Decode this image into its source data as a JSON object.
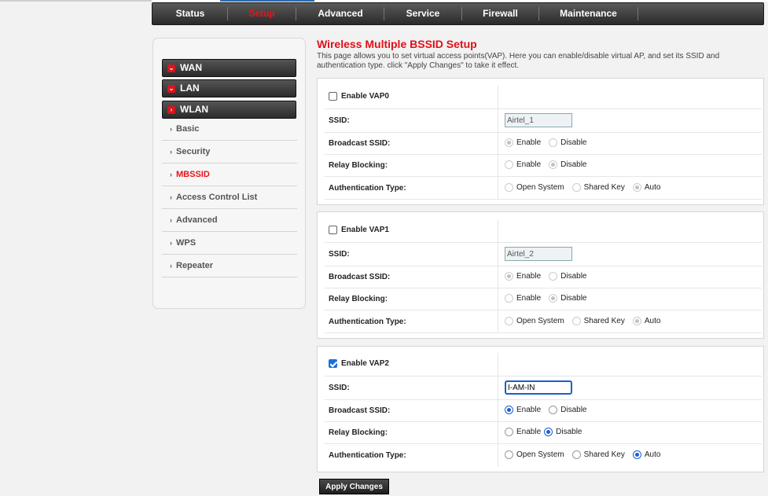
{
  "topnav": {
    "tabs": [
      {
        "label": "Status"
      },
      {
        "label": "Setup"
      },
      {
        "label": "Advanced"
      },
      {
        "label": "Service"
      },
      {
        "label": "Firewall"
      },
      {
        "label": "Maintenance"
      }
    ]
  },
  "sidebar": {
    "sections": [
      {
        "label": "WAN",
        "icon": "chevron-down-icon"
      },
      {
        "label": "LAN",
        "icon": "chevron-down-icon"
      },
      {
        "label": "WLAN",
        "icon": "chevron-right-icon"
      }
    ],
    "items": [
      {
        "label": "Basic"
      },
      {
        "label": "Security"
      },
      {
        "label": "MBSSID"
      },
      {
        "label": "Access Control List"
      },
      {
        "label": "Advanced"
      },
      {
        "label": "WPS"
      },
      {
        "label": "Repeater"
      }
    ]
  },
  "page": {
    "title": "Wireless Multiple BSSID Setup",
    "description": "This page allows you to set virtual access points(VAP). Here you can enable/disable virtual AP, and set its SSID and authentication type. click \"Apply Changes\" to take it effect."
  },
  "labels": {
    "ssid": "SSID:",
    "broadcast": "Broadcast SSID:",
    "relay": "Relay Blocking:",
    "auth": "Authentication Type:",
    "enable": "Enable",
    "disable": "Disable",
    "open": "Open System",
    "shared": "Shared Key",
    "auto": "Auto"
  },
  "vaps": [
    {
      "label": "Enable VAP0",
      "enabled": false,
      "ssid": "Airtel_1",
      "broadcast": "Enable",
      "relay": "Disable",
      "auth": "Auto"
    },
    {
      "label": "Enable VAP1",
      "enabled": false,
      "ssid": "Airtel_2",
      "broadcast": "Enable",
      "relay": "Disable",
      "auth": "Auto"
    },
    {
      "label": "Enable VAP2",
      "enabled": true,
      "ssid": "I-AM-IN",
      "broadcast": "Enable",
      "relay": "Disable",
      "auth": "Auto"
    }
  ],
  "apply_label": "Apply Changes",
  "colors": {
    "accent": "#e01018",
    "selected": "#1a5fd0"
  }
}
